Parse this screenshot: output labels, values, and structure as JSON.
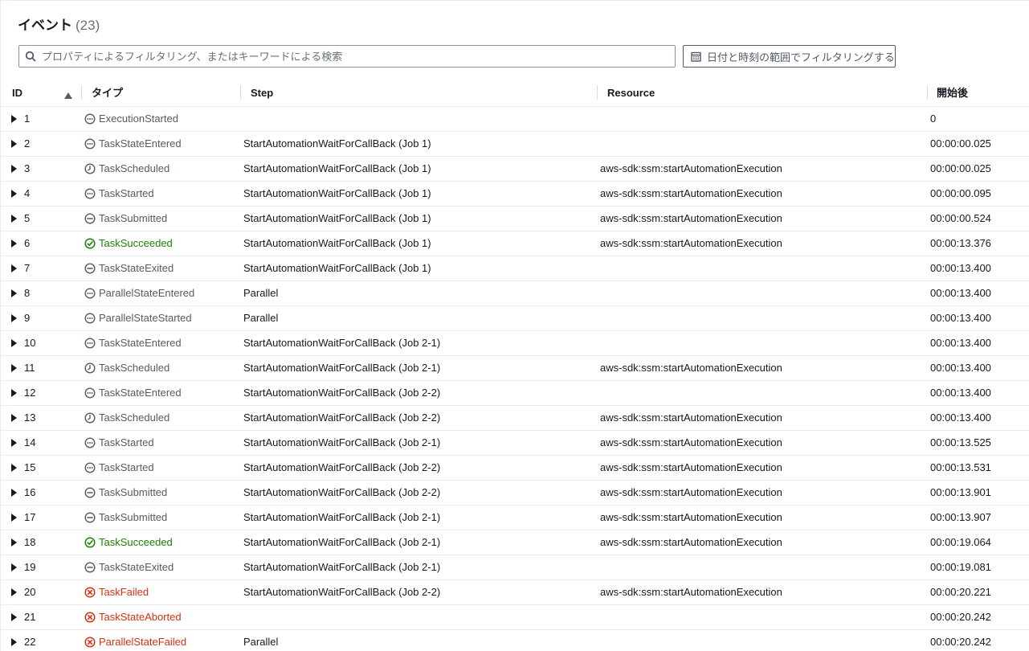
{
  "header": {
    "title": "イベント",
    "count": "(23)"
  },
  "search": {
    "placeholder": "プロパティによるフィルタリング、またはキーワードによる検索"
  },
  "date_filter": {
    "label": "日付と時刻の範囲でフィルタリングする"
  },
  "columns": {
    "id": "ID",
    "type": "タイプ",
    "step": "Step",
    "resource": "Resource",
    "elapsed": "開始後"
  },
  "sort": {
    "column": "ID",
    "direction": "ascending"
  },
  "colors": {
    "neutral": "#545b64",
    "success": "#1d8102",
    "error": "#d13212"
  },
  "rows": [
    {
      "id": "1",
      "type": "ExecutionStarted",
      "status": "neutral",
      "step": "",
      "resource": "",
      "elapsed": "0"
    },
    {
      "id": "2",
      "type": "TaskStateEntered",
      "status": "neutral",
      "step": "StartAutomationWaitForCallBack (Job 1)",
      "resource": "",
      "elapsed": "00:00:00.025"
    },
    {
      "id": "3",
      "type": "TaskScheduled",
      "status": "scheduled",
      "step": "StartAutomationWaitForCallBack (Job 1)",
      "resource": "aws-sdk:ssm:startAutomationExecution",
      "elapsed": "00:00:00.025"
    },
    {
      "id": "4",
      "type": "TaskStarted",
      "status": "neutral",
      "step": "StartAutomationWaitForCallBack (Job 1)",
      "resource": "aws-sdk:ssm:startAutomationExecution",
      "elapsed": "00:00:00.095"
    },
    {
      "id": "5",
      "type": "TaskSubmitted",
      "status": "stopped",
      "step": "StartAutomationWaitForCallBack (Job 1)",
      "resource": "aws-sdk:ssm:startAutomationExecution",
      "elapsed": "00:00:00.524"
    },
    {
      "id": "6",
      "type": "TaskSucceeded",
      "status": "success",
      "step": "StartAutomationWaitForCallBack (Job 1)",
      "resource": "aws-sdk:ssm:startAutomationExecution",
      "elapsed": "00:00:13.376"
    },
    {
      "id": "7",
      "type": "TaskStateExited",
      "status": "stopped",
      "step": "StartAutomationWaitForCallBack (Job 1)",
      "resource": "",
      "elapsed": "00:00:13.400"
    },
    {
      "id": "8",
      "type": "ParallelStateEntered",
      "status": "neutral",
      "step": "Parallel",
      "resource": "",
      "elapsed": "00:00:13.400"
    },
    {
      "id": "9",
      "type": "ParallelStateStarted",
      "status": "neutral",
      "step": "Parallel",
      "resource": "",
      "elapsed": "00:00:13.400"
    },
    {
      "id": "10",
      "type": "TaskStateEntered",
      "status": "neutral",
      "step": "StartAutomationWaitForCallBack (Job 2-1)",
      "resource": "",
      "elapsed": "00:00:13.400"
    },
    {
      "id": "11",
      "type": "TaskScheduled",
      "status": "scheduled",
      "step": "StartAutomationWaitForCallBack (Job 2-1)",
      "resource": "aws-sdk:ssm:startAutomationExecution",
      "elapsed": "00:00:13.400"
    },
    {
      "id": "12",
      "type": "TaskStateEntered",
      "status": "neutral",
      "step": "StartAutomationWaitForCallBack (Job 2-2)",
      "resource": "",
      "elapsed": "00:00:13.400"
    },
    {
      "id": "13",
      "type": "TaskScheduled",
      "status": "scheduled",
      "step": "StartAutomationWaitForCallBack (Job 2-2)",
      "resource": "aws-sdk:ssm:startAutomationExecution",
      "elapsed": "00:00:13.400"
    },
    {
      "id": "14",
      "type": "TaskStarted",
      "status": "neutral",
      "step": "StartAutomationWaitForCallBack (Job 2-1)",
      "resource": "aws-sdk:ssm:startAutomationExecution",
      "elapsed": "00:00:13.525"
    },
    {
      "id": "15",
      "type": "TaskStarted",
      "status": "neutral",
      "step": "StartAutomationWaitForCallBack (Job 2-2)",
      "resource": "aws-sdk:ssm:startAutomationExecution",
      "elapsed": "00:00:13.531"
    },
    {
      "id": "16",
      "type": "TaskSubmitted",
      "status": "stopped",
      "step": "StartAutomationWaitForCallBack (Job 2-2)",
      "resource": "aws-sdk:ssm:startAutomationExecution",
      "elapsed": "00:00:13.901"
    },
    {
      "id": "17",
      "type": "TaskSubmitted",
      "status": "stopped",
      "step": "StartAutomationWaitForCallBack (Job 2-1)",
      "resource": "aws-sdk:ssm:startAutomationExecution",
      "elapsed": "00:00:13.907"
    },
    {
      "id": "18",
      "type": "TaskSucceeded",
      "status": "success",
      "step": "StartAutomationWaitForCallBack (Job 2-1)",
      "resource": "aws-sdk:ssm:startAutomationExecution",
      "elapsed": "00:00:19.064"
    },
    {
      "id": "19",
      "type": "TaskStateExited",
      "status": "stopped",
      "step": "StartAutomationWaitForCallBack (Job 2-1)",
      "resource": "",
      "elapsed": "00:00:19.081"
    },
    {
      "id": "20",
      "type": "TaskFailed",
      "status": "error",
      "step": "StartAutomationWaitForCallBack (Job 2-2)",
      "resource": "aws-sdk:ssm:startAutomationExecution",
      "elapsed": "00:00:20.221"
    },
    {
      "id": "21",
      "type": "TaskStateAborted",
      "status": "error",
      "step": "",
      "resource": "",
      "elapsed": "00:00:20.242"
    },
    {
      "id": "22",
      "type": "ParallelStateFailed",
      "status": "error",
      "step": "Parallel",
      "resource": "",
      "elapsed": "00:00:20.242"
    }
  ]
}
